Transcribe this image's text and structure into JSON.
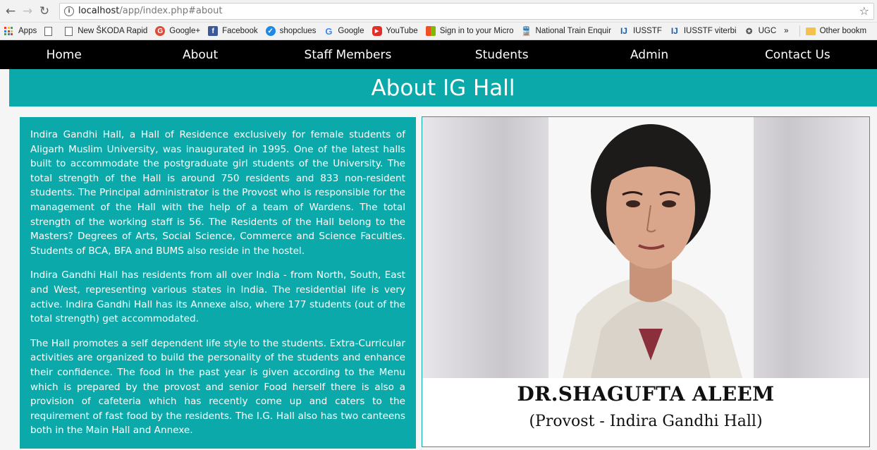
{
  "browser": {
    "url_host": "localhost",
    "url_path": "/app/index.php#about",
    "bookmarks": [
      {
        "label": "Apps",
        "icon": "apps-grid-icon"
      },
      {
        "label": "",
        "icon": "page-icon"
      },
      {
        "label": "New ŠKODA Rapid",
        "icon": "page-icon"
      },
      {
        "label": "Google+",
        "icon": "google-plus-icon",
        "color": "#dd4b39"
      },
      {
        "label": "Facebook",
        "icon": "facebook-icon",
        "color": "#3b5998"
      },
      {
        "label": "shopclues",
        "icon": "shopclues-icon",
        "color": "#1e88e5"
      },
      {
        "label": "Google",
        "icon": "google-icon",
        "color": "#4285f4"
      },
      {
        "label": "YouTube",
        "icon": "youtube-icon",
        "color": "#e52d27"
      },
      {
        "label": "Sign in to your Micro",
        "icon": "microsoft-icon"
      },
      {
        "label": "National Train Enquir",
        "icon": "train-icon"
      },
      {
        "label": "IUSSTF",
        "icon": "iusstf-icon",
        "color": "#1a5ea8"
      },
      {
        "label": "IUSSTF viterbi",
        "icon": "iusstf-icon",
        "color": "#1a5ea8"
      },
      {
        "label": "UGC",
        "icon": "ugc-icon"
      }
    ],
    "more": "»",
    "other_bookmarks": "Other bookm"
  },
  "nav": {
    "items": [
      "Home",
      "About",
      "Staff Members",
      "Students",
      "Admin",
      "Contact Us"
    ]
  },
  "page": {
    "title": "About IG Hall",
    "paragraphs": [
      "Indira Gandhi Hall, a Hall of Residence exclusively for female students of Aligarh Muslim University, was inaugurated in 1995. One of the latest halls built to accommodate the postgraduate girl students of the University. The total strength of the Hall is around 750 residents and 833 non-resident students. The Principal administrator is the Provost who is responsible for the management of the Hall with the help of a team of Wardens. The total strength of the working staff is 56. The Residents of the Hall belong to the Masters? Degrees of Arts, Social Science, Commerce and Science Faculties. Students of BCA, BFA and BUMS also reside in the hostel.",
      "Indira Gandhi Hall has residents from all over India - from North, South, East and West, representing various states in India. The residential life is very active. Indira Gandhi Hall has its Annexe also, where 177 students (out of the total strength) get accommodated.",
      "The Hall promotes a self dependent life style to the students. Extra-Curricular activities are organized to build the personality of the students and enhance their confidence. The food in the past year is given according to the Menu which is prepared by the provost and senior Food herself there is also a provision of cafeteria which has recently come up and caters to the requirement of fast food by the residents. The I.G. Hall also has two canteens both in the Main Hall and Annexe."
    ],
    "provost_name": "DR.SHAGUFTA ALEEM",
    "provost_role": "(Provost - Indira Gandhi Hall)"
  },
  "colors": {
    "accent": "#0ba9a9",
    "nav_bg": "#000000"
  }
}
